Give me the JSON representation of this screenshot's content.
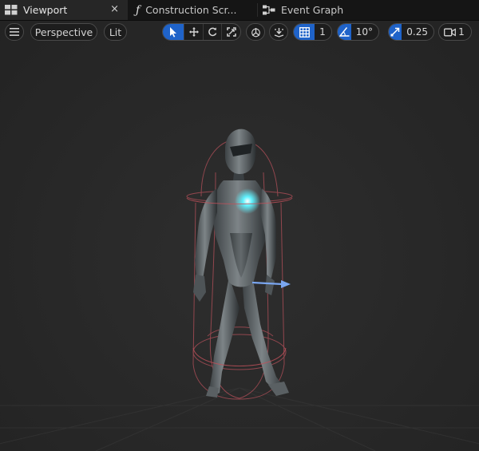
{
  "tabs": [
    {
      "label": "Viewport",
      "icon": "viewport-icon",
      "close": "×"
    },
    {
      "label": "Construction Scr...",
      "icon": "function-icon",
      "glyph": "ƒ"
    },
    {
      "label": "Event Graph",
      "icon": "event-graph-icon"
    }
  ],
  "toolbar": {
    "menu_icon": "hamburger-menu-icon",
    "view_mode": "Perspective",
    "lighting_mode": "Lit",
    "grid_snap_value": "1",
    "rotation_snap_value": "10°",
    "scale_snap_value": "0.25",
    "camera_speed_value": "1"
  },
  "colors": {
    "accent": "#1f63c9",
    "capsule": "#c0505a",
    "arrow": "#7aa6f0",
    "glow": "#5ff2ff"
  }
}
